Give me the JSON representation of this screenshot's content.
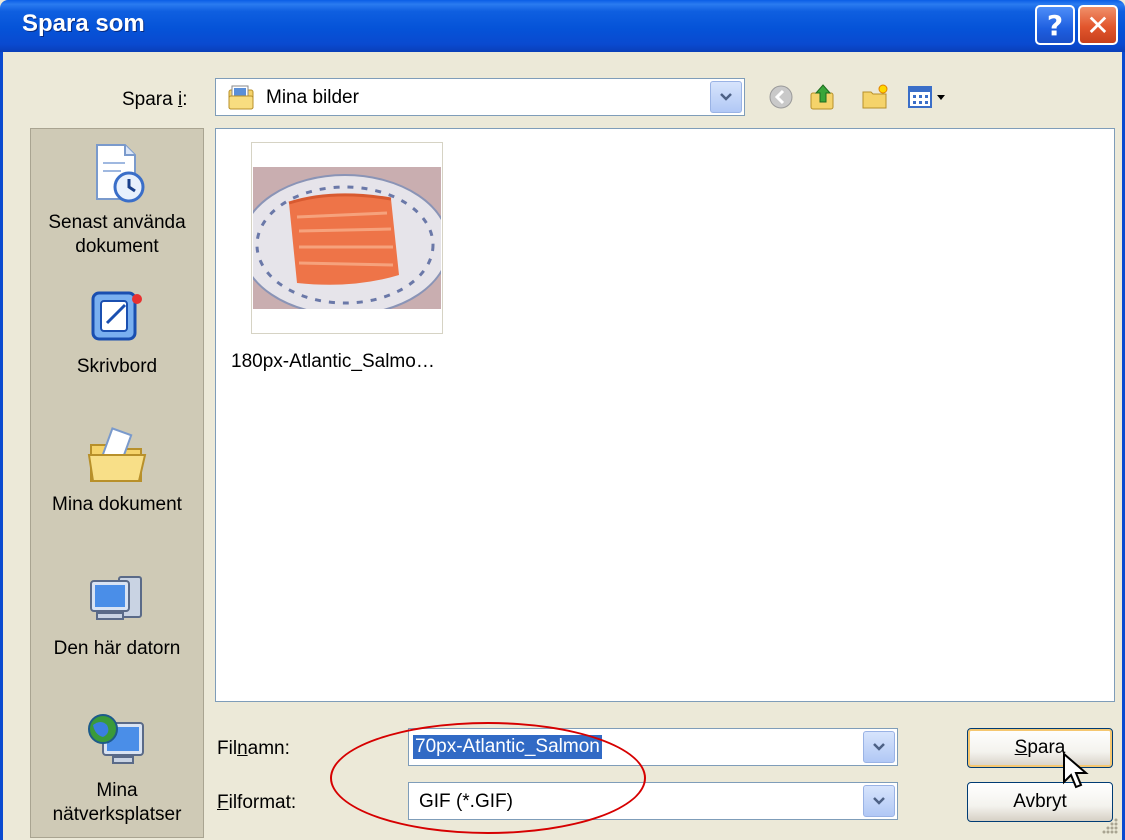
{
  "window": {
    "title": "Spara som",
    "help_glyph": "?",
    "close_glyph": "✕"
  },
  "save_in": {
    "label_prefix": "Spara ",
    "label_mnemonic": "i",
    "label_suffix": ":",
    "value": "Mina bilder"
  },
  "toolbar": {
    "icons": [
      "back-icon",
      "up-folder-icon",
      "new-folder-icon",
      "views-menu-icon"
    ]
  },
  "places": [
    {
      "label": "Senast använda dokument",
      "icon": "recent-documents-icon"
    },
    {
      "label": "Skrivbord",
      "icon": "desktop-icon"
    },
    {
      "label": "Mina dokument",
      "icon": "my-documents-icon"
    },
    {
      "label": "Den här datorn",
      "icon": "my-computer-icon"
    },
    {
      "label": "Mina nätverksplatser",
      "icon": "network-places-icon"
    }
  ],
  "files": [
    {
      "name": "180px-Atlantic_Salmo…",
      "icon": "salmon-thumbnail"
    }
  ],
  "filename": {
    "label_prefix": "Fil",
    "label_mnemonic": "n",
    "label_suffix": "amn:",
    "value": "70px-Atlantic_Salmon"
  },
  "fileformat": {
    "label_prefix": "",
    "label_mnemonic": "F",
    "label_suffix": "ilformat:",
    "value": "GIF (*.GIF)"
  },
  "buttons": {
    "save_mnemonic": "S",
    "save_rest": "para",
    "cancel": "Avbryt"
  },
  "colors": {
    "titlebar": "#0553d8",
    "selection": "#316ac5",
    "highlight": "#d60000"
  }
}
